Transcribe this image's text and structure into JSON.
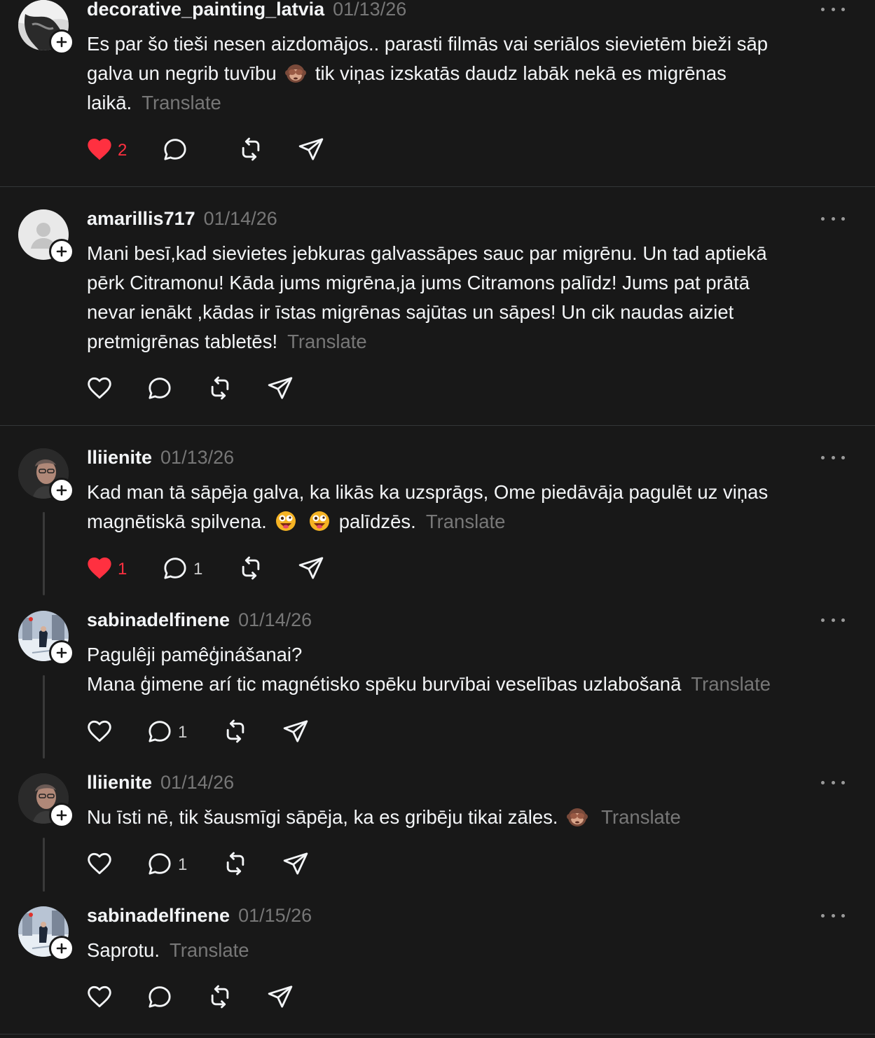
{
  "colors": {
    "background": "#181818",
    "text": "#f3f5f7",
    "muted": "#777777",
    "like": "#ff3040"
  },
  "posts": [
    {
      "username": "decorative_painting_latvia",
      "date": "01/13/26",
      "lines": [
        "Es par šo tieši nesen aizdomājos.. parasti filmās vai seriālos sievietēm bieži sāp",
        [
          "galva un negrib tuvību ",
          "emoji:monkey",
          " tik viņas izskatās daudz labāk nekā es migrēnas"
        ],
        "laikā."
      ],
      "translate": "Translate",
      "liked": true,
      "likes": "2",
      "replies": "",
      "avatar": "painting"
    },
    {
      "username": "amarillis717",
      "date": "01/14/26",
      "lines": [
        "Mani besī,kad sievietes jebkuras galvassāpes sauc par migrēnu. Un tad aptiekā",
        "pērk Citramonu! Kāda jums migrēna,ja jums Citramons palīdz! Jums pat prātā",
        "nevar ienākt ,kādas ir īstas migrēnas sajūtas un sāpes! Un cik naudas aiziet",
        "pretmigrēnas tabletēs!"
      ],
      "translate": "Translate",
      "liked": false,
      "likes": "",
      "replies": "",
      "avatar": "default"
    },
    {
      "username": "lliienite",
      "date": "01/13/26",
      "lines": [
        "Kad man tā sāpēja galva, ka likās ka uzsprāgs, Ome piedāvāja pagulēt uz viņas",
        [
          "magnētiskā spilvena. ",
          "emoji:zany",
          " ",
          "emoji:zany",
          " palīdzēs."
        ]
      ],
      "translate": "Translate",
      "liked": true,
      "likes": "1",
      "replies": "1",
      "avatar": "woman"
    },
    {
      "username": "sabinadelfinene",
      "date": "01/14/26",
      "lines": [
        "Pagulêji pamêģinášanai?",
        "Mana ģimene arí tic magnétisko spēku burvībai veselības uzlabošanā"
      ],
      "translate": "Translate",
      "liked": false,
      "likes": "",
      "replies": "1",
      "avatar": "street"
    },
    {
      "username": "lliienite",
      "date": "01/14/26",
      "lines": [
        [
          "Nu īsti nē, tik šausmīgi sāpēja, ka es gribēju tikai zāles. ",
          "emoji:monkey"
        ]
      ],
      "translate": "Translate",
      "liked": false,
      "likes": "",
      "replies": "1",
      "avatar": "woman"
    },
    {
      "username": "sabinadelfinene",
      "date": "01/15/26",
      "lines": [
        "Saprotu."
      ],
      "translate": "Translate",
      "liked": false,
      "likes": "",
      "replies": "",
      "avatar": "street"
    }
  ],
  "icons": {
    "like": "heart-icon",
    "reply": "comment-icon",
    "repost": "repost-icon",
    "share": "send-icon",
    "more": "more-options-icon",
    "follow": "plus-icon"
  }
}
